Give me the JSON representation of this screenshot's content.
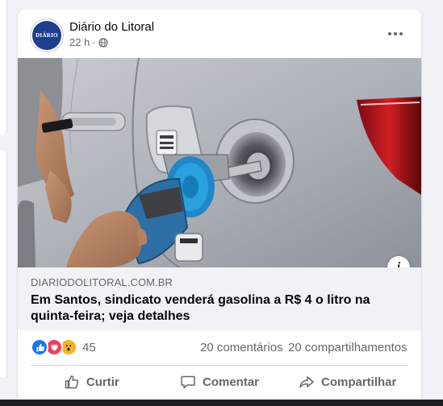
{
  "post": {
    "page_name": "Diário do Litoral",
    "avatar_text": "DIÁRIO",
    "time": "22 h",
    "separator": "·",
    "audience_icon": "globe-icon",
    "more_icon": "more-options-icon"
  },
  "link": {
    "domain": "DIARIODOLITORAL.COM.BR",
    "title": "Em Santos, sindicato venderá gasolina a R$ 4 o litro na quinta-feira; veja detalhes",
    "info_icon": "i"
  },
  "reactions": {
    "icons": [
      "like-reaction-icon",
      "love-reaction-icon",
      "wow-reaction-icon"
    ],
    "count": "45",
    "comments": "20 comentários",
    "shares": "20 compartilhamentos"
  },
  "actions": {
    "like_label": "Curtir",
    "comment_label": "Comentar",
    "share_label": "Compartilhar"
  },
  "colors": {
    "like": "#1877f2",
    "love": "#f33e58",
    "wow": "#f7b125",
    "avatar_bg": "#1d3f8f"
  }
}
